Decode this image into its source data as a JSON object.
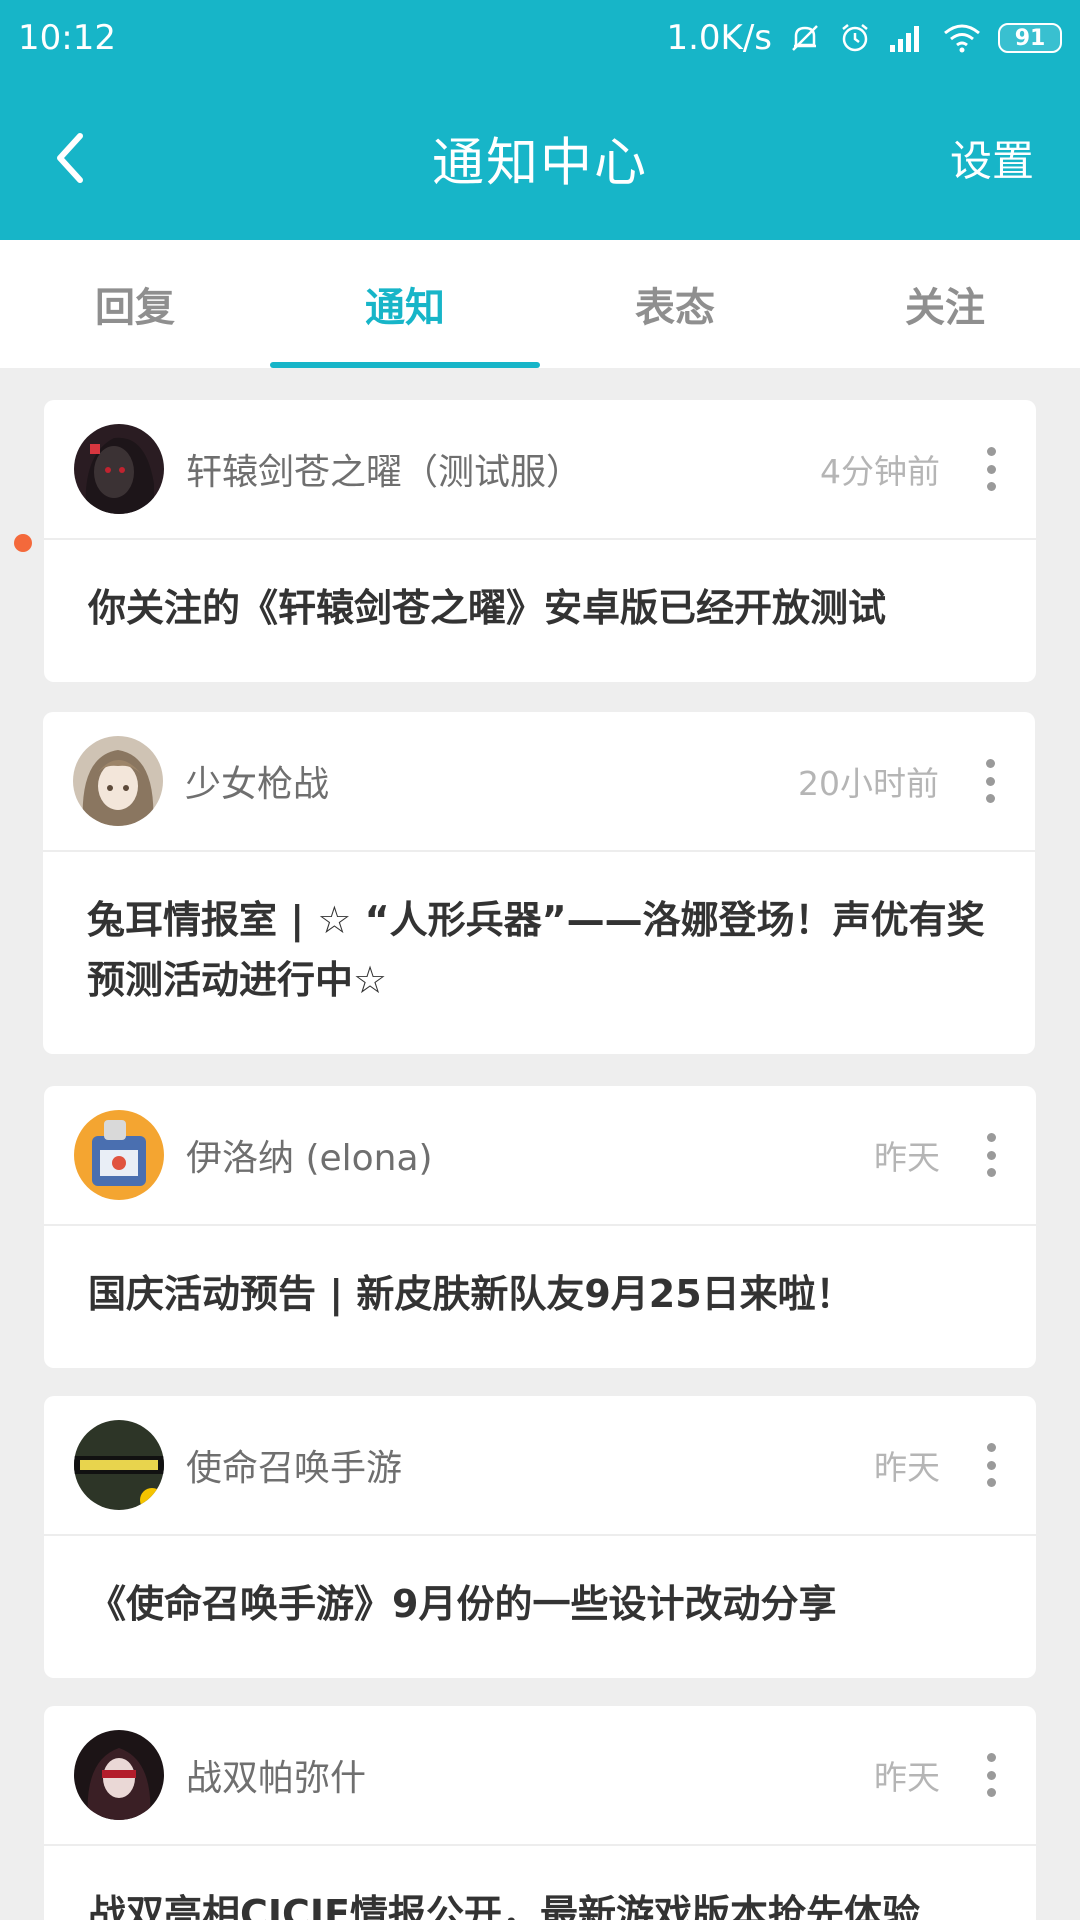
{
  "status_bar": {
    "time": "10:12",
    "network_speed": "1.0K/s",
    "icons": [
      "mute-icon",
      "alarm-icon",
      "signal-icon",
      "wifi-icon"
    ],
    "battery": "91"
  },
  "header": {
    "title": "通知中心",
    "settings_label": "设置",
    "back_icon": "chevron-left-icon",
    "background_color": "#17b5c8"
  },
  "tabs": [
    {
      "label": "回复",
      "active": false
    },
    {
      "label": "通知",
      "active": true
    },
    {
      "label": "表态",
      "active": false
    },
    {
      "label": "关注",
      "active": false
    }
  ],
  "notifications": [
    {
      "source": "轩辕剑苍之曜（测试服）",
      "time": "4分钟前",
      "message": "你关注的《轩辕剑苍之曜》安卓版已经开放测试",
      "unread": true
    },
    {
      "source": "少女枪战",
      "time": "20小时前",
      "message": "兔耳情报室 | ☆ “人形兵器”——洛娜登场！声优有奖预测活动进行中☆",
      "unread": false
    },
    {
      "source": "伊洛纳 (elona)",
      "time": "昨天",
      "message": "国庆活动预告 | 新皮肤新队友9月25日来啦！",
      "unread": false
    },
    {
      "source": "使命召唤手游",
      "time": "昨天",
      "message": "《使命召唤手游》9月份的一些设计改动分享",
      "unread": false
    },
    {
      "source": "战双帕弥什",
      "time": "昨天",
      "message": "战双亮相CICJF情报公开，最新游戏版本抢先体验",
      "unread": false
    }
  ],
  "colors": {
    "accent": "#17b5c8",
    "unread_dot": "#f4693b"
  }
}
